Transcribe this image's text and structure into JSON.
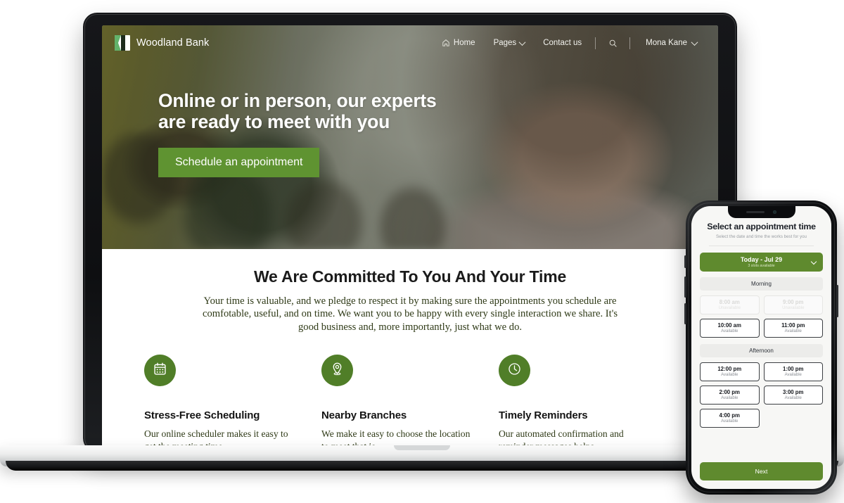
{
  "site": {
    "nav": {
      "brand": "Woodland Bank",
      "brand_logo_icon": "woodland-leaf-logo",
      "links": [
        {
          "label": "Home",
          "icon": "home-icon",
          "has_chevron": false
        },
        {
          "label": "Pages",
          "icon": "",
          "has_chevron": true
        },
        {
          "label": "Contact us",
          "icon": "",
          "has_chevron": false
        }
      ],
      "search_icon": "search-icon",
      "user": {
        "label": "Mona Kane",
        "chevron_icon": "chevron-down-icon"
      }
    },
    "hero": {
      "title_line1": "Online or in person, our experts",
      "title_line2": "are ready to meet with you",
      "cta_label": "Schedule an appointment"
    },
    "committed": {
      "heading": "We Are Committed To You And Your Time",
      "paragraph": "Your time is valuable, and we pledge to respect it by making sure the appointments you schedule are comfotable, useful, and on time. We want you to be happy with every single interaction we share. It's good business and, more importantly, just what we do."
    },
    "features": [
      {
        "icon": "calendar-icon",
        "title": "Stress-Free Scheduling",
        "body": "Our online scheduler makes it easy to get the meeting time"
      },
      {
        "icon": "map-pin-icon",
        "title": "Nearby Branches",
        "body": "We make it easy to choose the location to meet that is"
      },
      {
        "icon": "clock-icon",
        "title": "Timely Reminders",
        "body": "Our automated confirmation and reminder messages helps"
      }
    ]
  },
  "phone_app": {
    "title": "Select an appointment time",
    "subtitle": "Select the date and time the works best for you",
    "date_selector": {
      "label": "Today - Jul 29",
      "sub_label": "3 slots available",
      "chevron_icon": "chevron-down-icon"
    },
    "sections": [
      {
        "header": "Morning",
        "slots": [
          {
            "time": "8:00 am",
            "state": "Unavailable",
            "available": false
          },
          {
            "time": "9:00 pm",
            "state": "Unavailable",
            "available": false
          },
          {
            "time": "10:00 am",
            "state": "Available",
            "available": true
          },
          {
            "time": "11:00 pm",
            "state": "Available",
            "available": true
          }
        ]
      },
      {
        "header": "Afternoon",
        "slots": [
          {
            "time": "12:00 pm",
            "state": "Available",
            "available": true
          },
          {
            "time": "1:00 pm",
            "state": "Available",
            "available": true
          },
          {
            "time": "2:00 pm",
            "state": "Available",
            "available": true
          },
          {
            "time": "3:00 pm",
            "state": "Available",
            "available": true
          },
          {
            "time": "4:00 pm",
            "state": "Available",
            "available": true
          }
        ]
      }
    ],
    "next_label": "Next"
  },
  "colors": {
    "brand_green": "#507e28",
    "cta_green": "#5f9331",
    "phone_green": "#5f8a2e",
    "serif_text": "#2f3a17"
  }
}
